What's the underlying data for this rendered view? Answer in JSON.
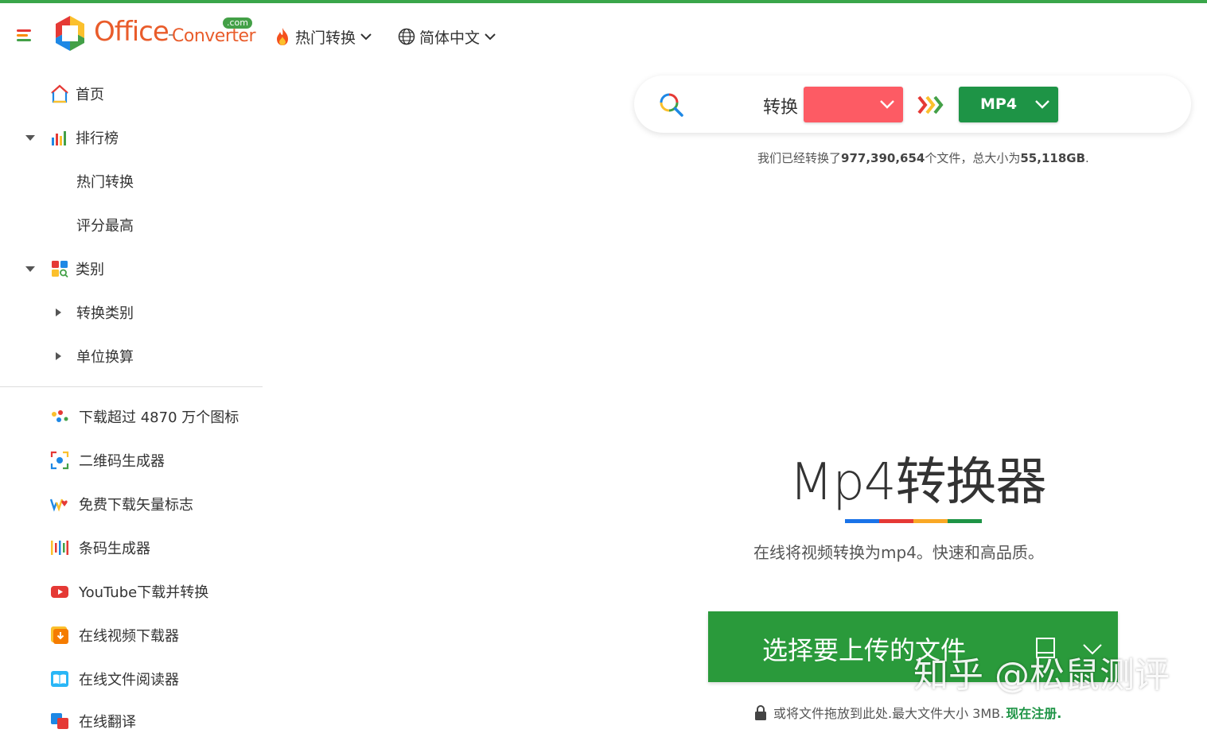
{
  "header": {
    "logo_word": "Office",
    "logo_word2": "Converter",
    "logo_tld": ".com",
    "nav": [
      {
        "label": "热门转换"
      },
      {
        "label": "简体中文"
      }
    ]
  },
  "sidebar": {
    "items": [
      {
        "label": "首页"
      },
      {
        "label": "排行榜"
      },
      {
        "label": "热门转换"
      },
      {
        "label": "评分最高"
      },
      {
        "label": "类别"
      },
      {
        "label": "转换类别"
      },
      {
        "label": "单位换算"
      }
    ],
    "tools": [
      {
        "label": "下载超过 4870 万个图标"
      },
      {
        "label": "二维码生成器"
      },
      {
        "label": "免费下载矢量标志"
      },
      {
        "label": "条码生成器"
      },
      {
        "label": "YouTube下载并转换"
      },
      {
        "label": "在线视频下载器"
      },
      {
        "label": "在线文件阅读器"
      },
      {
        "label": "在线翻译"
      }
    ]
  },
  "converter": {
    "label": "转换",
    "from_value": "",
    "to_value": "MP4"
  },
  "stats": {
    "prefix": "我们已经转换了",
    "count": "977,390,654",
    "middle": "个文件，总大小为",
    "size": "55,118GB",
    "suffix": "."
  },
  "hero": {
    "title": "Mp4转换器",
    "subtitle": "在线将视频转换为mp4。快速和高品质。"
  },
  "upload": {
    "button_label": "选择要上传的文件",
    "note": "或将文件拖放到此处.最大文件大小 3MB.",
    "register": "现在注册."
  },
  "watermark": "知乎 @松鼠测评",
  "colors": {
    "accent_green": "#2a9a3b",
    "from_red": "#fd5b64",
    "underline": [
      "#1a73e8",
      "#e53935",
      "#f9a825",
      "#1e9446"
    ]
  }
}
